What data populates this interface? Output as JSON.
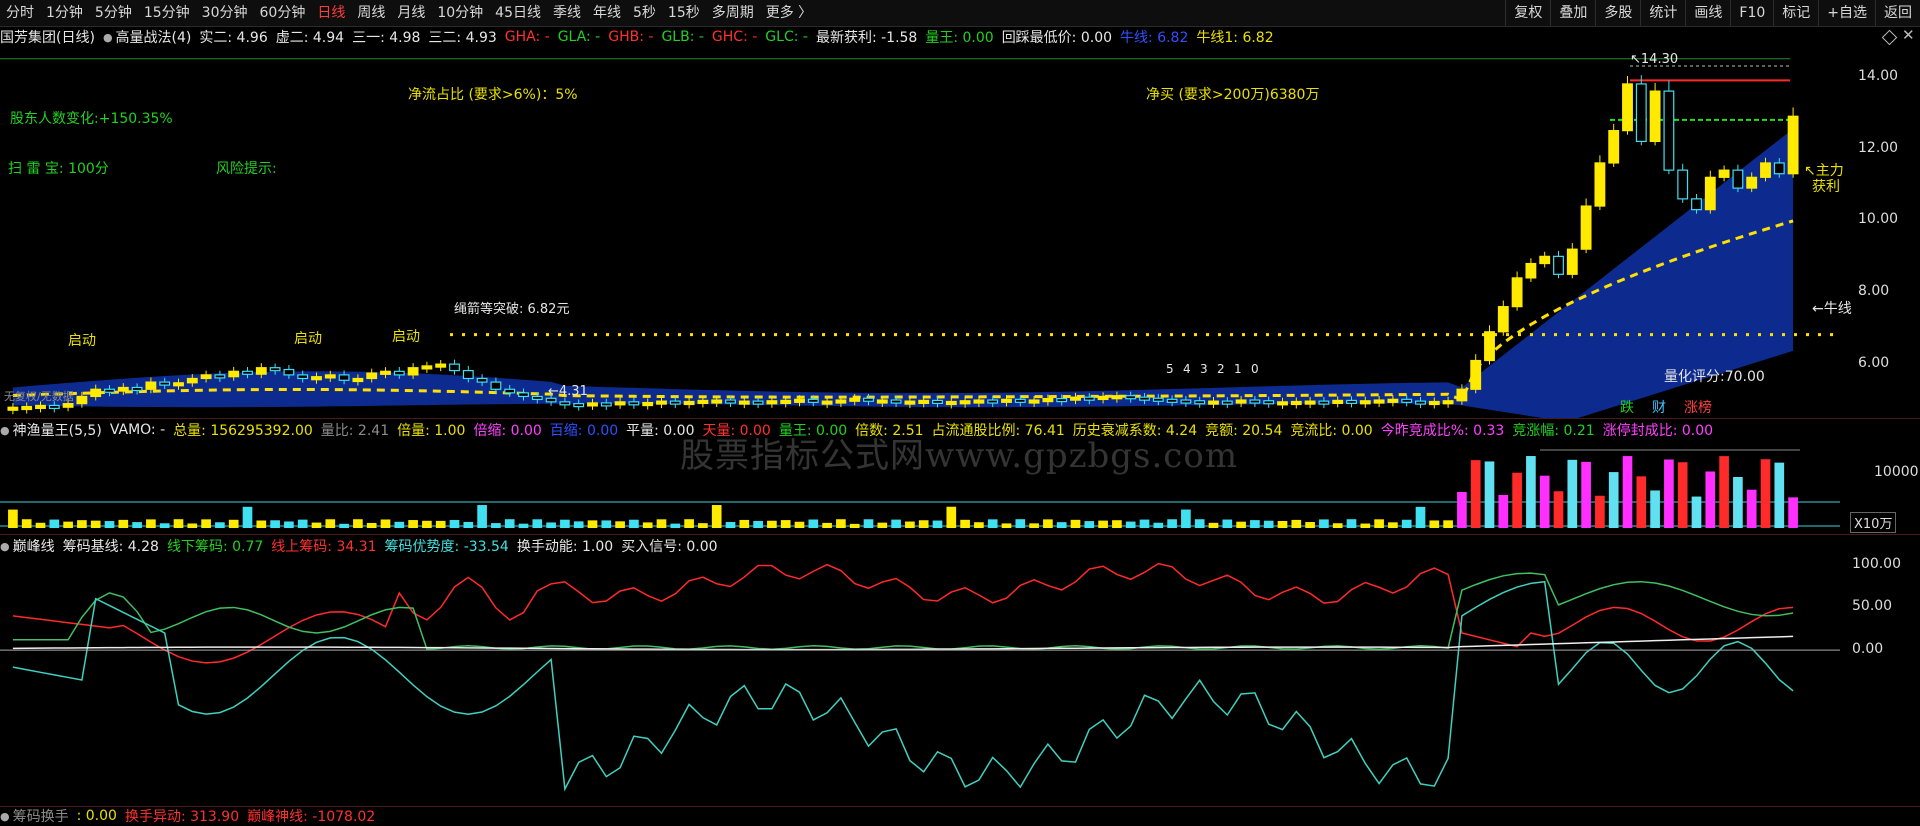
{
  "toolbar": {
    "periods": [
      "分时",
      "1分钟",
      "5分钟",
      "15分钟",
      "30分钟",
      "60分钟",
      "日线",
      "周线",
      "月线",
      "10分钟",
      "45日线",
      "季线",
      "年线",
      "5秒",
      "15秒",
      "多周期",
      "更多 〉"
    ],
    "active_period": "日线",
    "right_tools": [
      "复权",
      "叠加",
      "多股",
      "统计",
      "画线",
      "F10",
      "标记",
      "+自选",
      "返回"
    ]
  },
  "main_legend": {
    "title": "国芳集团(日线)",
    "indicator": "高量战法(4)",
    "items": [
      {
        "label": "实二: 4.96",
        "color": "w"
      },
      {
        "label": "虚二: 4.94",
        "color": "w"
      },
      {
        "label": "三一: 4.98",
        "color": "w"
      },
      {
        "label": "三二: 4.93",
        "color": "w"
      },
      {
        "label": "GHA: -",
        "color": "r"
      },
      {
        "label": "GLA: -",
        "color": "g"
      },
      {
        "label": "GHB: -",
        "color": "r"
      },
      {
        "label": "GLB: -",
        "color": "g"
      },
      {
        "label": "GHC: -",
        "color": "r"
      },
      {
        "label": "GLC: -",
        "color": "g"
      },
      {
        "label": "最新获利: -1.58",
        "color": "w"
      },
      {
        "label": "量王: 0.00",
        "color": "g"
      },
      {
        "label": "回踩最低价: 0.00",
        "color": "w"
      },
      {
        "label": "牛线: 6.82",
        "color": "b"
      },
      {
        "label": "牛线1: 6.82",
        "color": "y"
      }
    ]
  },
  "main_annotations": {
    "flow_ratio": "净流占比 (要求>6%)：5%",
    "net_buy": "净买 (要求>200万)6380万",
    "holders_change": "股东人数变化:+150.35%",
    "scan": "扫 雷 宝:  100分",
    "risk": "风险提示:",
    "breakout": "绳箭等突破: 6.82元",
    "high_price": "14.30",
    "low_price": "4.31",
    "bull_line": "←牛线",
    "main_profit": "主力",
    "profit": "获利",
    "score": "量化评分:70.00",
    "start": "启动",
    "wave_labels": [
      "5",
      "4",
      "3",
      "2",
      "1",
      "0"
    ],
    "badges": [
      {
        "label": "跌",
        "color": "#22d022"
      },
      {
        "label": "财",
        "color": "#40c0ff"
      },
      {
        "label": "涨榜",
        "color": "#ff4040"
      }
    ],
    "no_data": "无复权/无数据"
  },
  "price_axis": [
    "14.00",
    "12.00",
    "10.00",
    "8.00",
    "6.00"
  ],
  "volume_legend": {
    "indicator": "神渔量王(5,5)",
    "items": [
      {
        "label": "VAMO: -",
        "color": "w"
      },
      {
        "label": "总量: 156295392.00",
        "color": "y"
      },
      {
        "label": "量比: 2.41",
        "color": "gr"
      },
      {
        "label": "倍量: 1.00",
        "color": "y"
      },
      {
        "label": "倍缩: 0.00",
        "color": "m"
      },
      {
        "label": "百缩: 0.00",
        "color": "b"
      },
      {
        "label": "平量: 0.00",
        "color": "w"
      },
      {
        "label": "天量: 0.00",
        "color": "r"
      },
      {
        "label": "量王: 0.00",
        "color": "g"
      },
      {
        "label": "倍数: 2.51",
        "color": "y"
      },
      {
        "label": "占流通股比例: 76.41",
        "color": "y"
      },
      {
        "label": "历史衰减系数: 4.24",
        "color": "y"
      },
      {
        "label": "竞额: 20.54",
        "color": "y"
      },
      {
        "label": "竞流比: 0.00",
        "color": "y"
      },
      {
        "label": "今昨竞成比%: 0.33",
        "color": "m"
      },
      {
        "label": "竞涨幅: 0.21",
        "color": "g"
      },
      {
        "label": "涨停封成比: 0.00",
        "color": "m"
      }
    ]
  },
  "volume_axis": [
    "10000"
  ],
  "volume_unit": "X10万",
  "chip_legend": {
    "indicator": "巅峰线",
    "items": [
      {
        "label": "筹码基线: 4.28",
        "color": "w"
      },
      {
        "label": "线下筹码: 0.77",
        "color": "g"
      },
      {
        "label": "线上筹码: 34.31",
        "color": "r"
      },
      {
        "label": "筹码优势度: -33.54",
        "color": "c"
      },
      {
        "label": "换手动能: 1.00",
        "color": "w"
      },
      {
        "label": "买入信号: 0.00",
        "color": "w"
      }
    ]
  },
  "chip_axis": [
    "100.00",
    "50.00",
    "0.00"
  ],
  "bottom_legend": {
    "items": [
      {
        "label": "筹码换手",
        "color": "gr"
      },
      {
        "label": ": 0.00",
        "color": "y"
      },
      {
        "label": "换手异动: 313.90",
        "color": "r"
      },
      {
        "label": "巅峰神线: -1078.02",
        "color": "r"
      }
    ]
  },
  "watermark": "股票指标公式网www.gpzbgs.com",
  "colors": {
    "up": "#ffea00",
    "down": "#40e0f0",
    "band": "#0d2a8f",
    "bull": "#ffe000",
    "red": "#ff2a2a",
    "green": "#22c022",
    "cyan": "#40d0c0"
  },
  "chart_data": {
    "type": "candlestick",
    "price_ylim": [
      4.5,
      14.8
    ],
    "closes": [
      4.8,
      4.82,
      4.85,
      4.8,
      4.9,
      5.1,
      5.3,
      5.25,
      5.35,
      5.3,
      5.5,
      5.42,
      5.48,
      5.6,
      5.7,
      5.65,
      5.8,
      5.72,
      5.9,
      5.85,
      5.7,
      5.6,
      5.65,
      5.7,
      5.55,
      5.6,
      5.75,
      5.8,
      5.7,
      5.9,
      5.95,
      6.0,
      5.82,
      5.6,
      5.5,
      5.3,
      5.2,
      5.1,
      5.05,
      4.95,
      4.9,
      4.85,
      4.92,
      4.88,
      4.95,
      4.9,
      4.93,
      4.97,
      4.91,
      4.96,
      4.99,
      5.0,
      4.95,
      4.97,
      4.94,
      4.98,
      4.99,
      5.02,
      4.96,
      4.97,
      5.0,
      5.05,
      4.98,
      5.0,
      4.95,
      4.97,
      4.99,
      4.93,
      4.96,
      4.98,
      5.0,
      4.97,
      5.02,
      4.98,
      5.0,
      5.04,
      5.0,
      5.08,
      5.06,
      5.1,
      5.12,
      5.08,
      5.05,
      5.02,
      5.0,
      4.98,
      4.95,
      4.97,
      4.96,
      5.0,
      4.98,
      4.94,
      4.95,
      4.96,
      4.97,
      4.95,
      4.99,
      4.96,
      4.98,
      5.0,
      5.02,
      4.97,
      4.95,
      4.96,
      4.98,
      5.3,
      6.1,
      6.9,
      7.6,
      8.4,
      8.8,
      9.0,
      8.5,
      9.2,
      10.4,
      11.6,
      12.5,
      13.8,
      12.2,
      13.6,
      11.4,
      10.6,
      10.3,
      11.2,
      11.4,
      10.9,
      11.2,
      11.6,
      11.3,
      12.9
    ],
    "chip_ylim": [
      -180,
      110
    ]
  }
}
